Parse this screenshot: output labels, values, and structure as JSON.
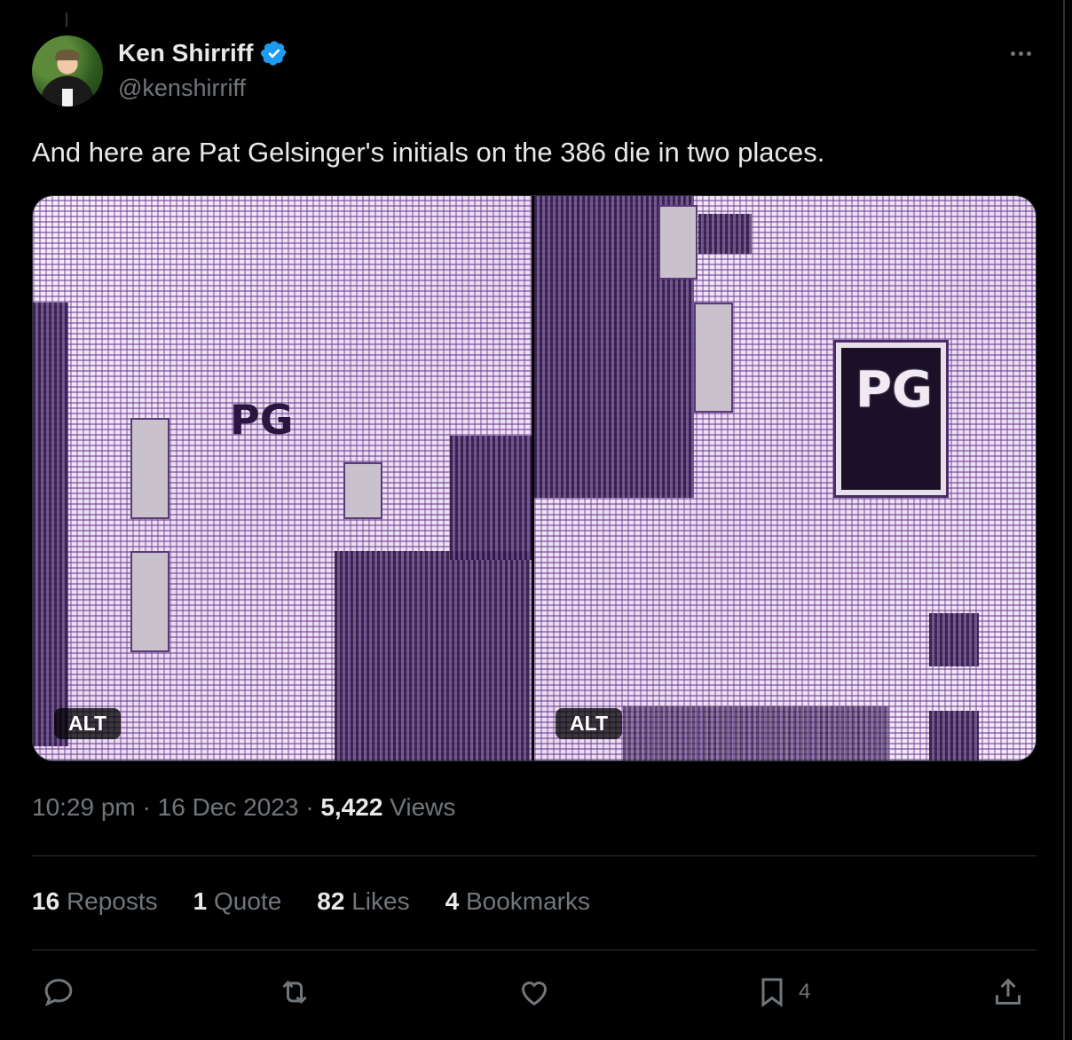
{
  "author": {
    "name": "Ken Shirriff",
    "handle": "@kenshirriff",
    "verified_color": "#1d9bf0"
  },
  "icons": {
    "verified": "verified-badge-icon",
    "more": "more-options-icon",
    "reply": "reply-icon",
    "repost": "repost-icon",
    "like": "like-icon",
    "bookmark": "bookmark-icon",
    "share": "share-icon"
  },
  "tweet": {
    "text": "And here are Pat Gelsinger's initials on the 386 die in two places.",
    "media": [
      {
        "alt_badge": "ALT",
        "overlay_text": "PG"
      },
      {
        "alt_badge": "ALT",
        "overlay_text": "PG"
      }
    ]
  },
  "meta": {
    "time": "10:29 pm",
    "date": "16 Dec 2023",
    "views_count": "5,422",
    "views_label": "Views",
    "separator": "·"
  },
  "stats": {
    "reposts_count": "16",
    "reposts_label": "Reposts",
    "quotes_count": "1",
    "quotes_label": "Quote",
    "likes_count": "82",
    "likes_label": "Likes",
    "bookmarks_count": "4",
    "bookmarks_label": "Bookmarks"
  },
  "actions": {
    "bookmark_count": "4"
  }
}
